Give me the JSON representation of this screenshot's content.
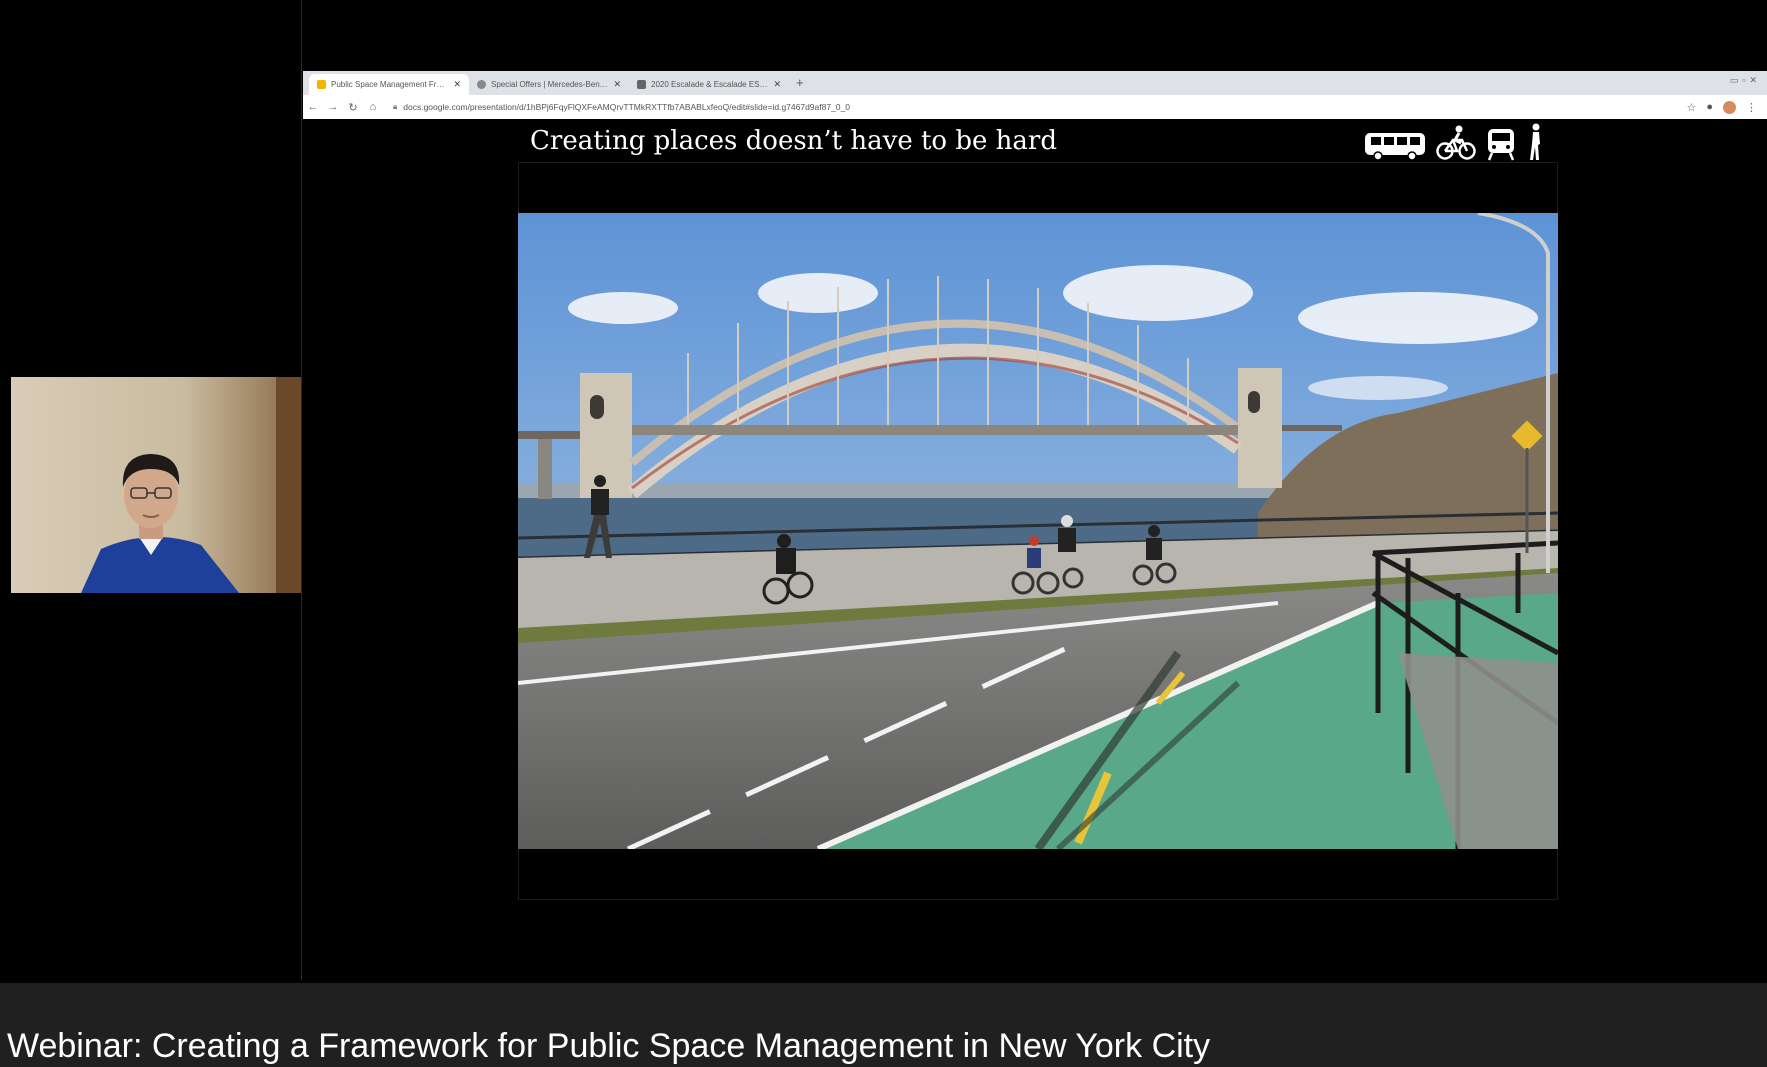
{
  "browser": {
    "tabs": [
      {
        "label": "Public Space Management Framework",
        "active": true,
        "favicon_color": "#f4b400"
      },
      {
        "label": "Special Offers | Mercedes-Benz USA",
        "active": false,
        "favicon_color": "#888888"
      },
      {
        "label": "2020 Escalade & Escalade ESV | Full Si...",
        "active": false,
        "favicon_color": "#666666"
      }
    ],
    "new_tab_glyph": "+",
    "url": "docs.google.com/presentation/d/1hBPj6FqyFlQXFeAMQrvTTMkRXTTfb7ABABLxfeoQ/edit#slide=id.g7467d9af87_0_0"
  },
  "slide": {
    "title": "Creating places doesn’t have to be hard",
    "mode_icons": [
      "bus-icon",
      "bicycle-icon",
      "train-icon",
      "pedestrian-icon"
    ]
  },
  "caption": {
    "text": "Webinar: Creating a Framework for Public Space Management in New York City"
  },
  "colors": {
    "background": "#000000",
    "caption_bar": "#202020",
    "bike_lane": "#5aa88a",
    "sky": "#8fb9e3"
  }
}
